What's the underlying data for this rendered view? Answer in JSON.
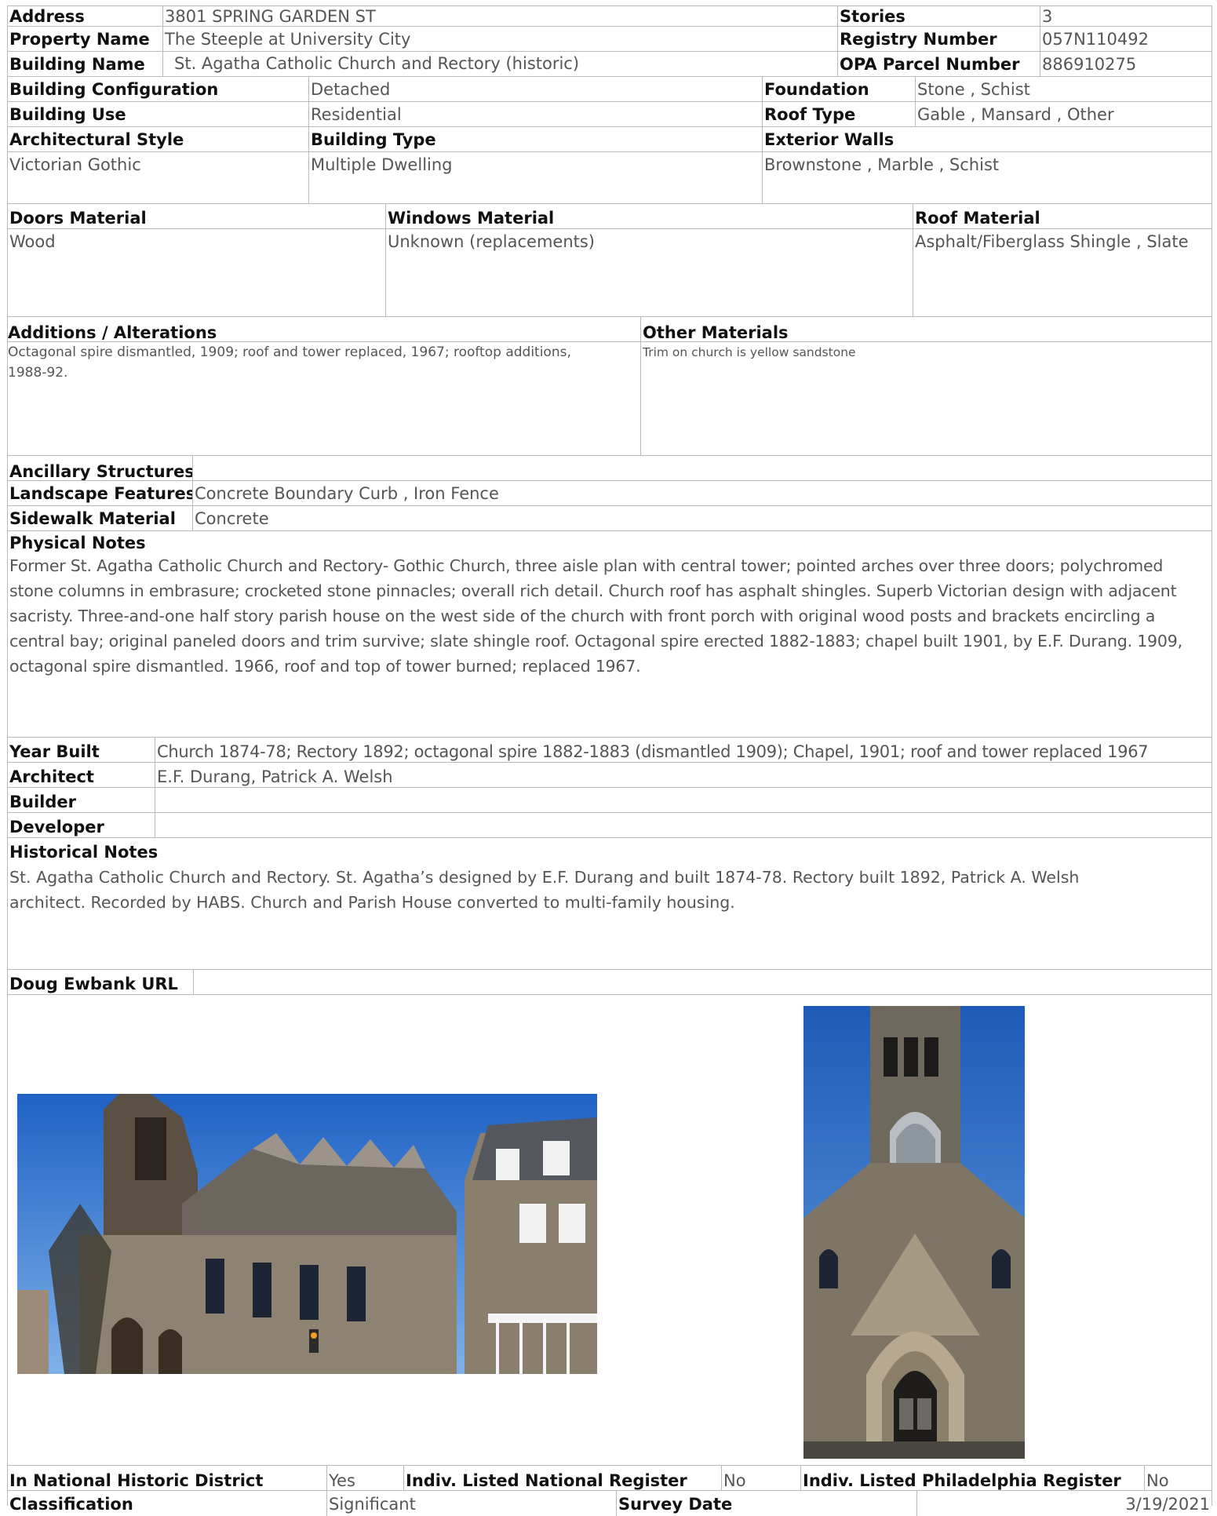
{
  "address": {
    "label": "Address",
    "value": "3801 SPRING GARDEN ST"
  },
  "property_name": {
    "label": "Property Name",
    "value": "The Steeple at University City"
  },
  "building_name": {
    "label": "Building Name",
    "value": "St. Agatha Catholic Church and Rectory (historic)"
  },
  "stories": {
    "label": "Stories",
    "value": "3"
  },
  "registry_number": {
    "label": "Registry Number",
    "value": "057N110492"
  },
  "opa_parcel": {
    "label": "OPA Parcel Number",
    "value": "886910275"
  },
  "building_configuration": {
    "label": "Building Configuration",
    "value": "Detached"
  },
  "building_use": {
    "label": "Building Use",
    "value": "Residential"
  },
  "foundation": {
    "label": "Foundation",
    "value": "Stone , Schist"
  },
  "roof_type": {
    "label": "Roof Type",
    "value": "Gable , Mansard , Other"
  },
  "architectural_style": {
    "label": "Architectural Style",
    "value": "Victorian Gothic"
  },
  "building_type": {
    "label": "Building Type",
    "value": "Multiple Dwelling"
  },
  "exterior_walls": {
    "label": "Exterior Walls",
    "value": "Brownstone , Marble , Schist"
  },
  "doors_material": {
    "label": "Doors Material",
    "value": "Wood"
  },
  "windows_material": {
    "label": "Windows Material",
    "value": "Unknown (replacements)"
  },
  "roof_material": {
    "label": "Roof Material",
    "value": "Asphalt/Fiberglass Shingle , Slate"
  },
  "additions": {
    "label": "Additions / Alterations",
    "value": "Octagonal spire dismantled, 1909; roof and tower replaced, 1967; rooftop additions, 1988-92."
  },
  "other_materials": {
    "label": "Other Materials",
    "value": "Trim on  church is yellow sandstone"
  },
  "ancillary_structures": {
    "label": "Ancillary Structures",
    "value": ""
  },
  "landscape_features": {
    "label": "Landscape Features",
    "value": "Concrete Boundary Curb , Iron Fence"
  },
  "sidewalk_material": {
    "label": "Sidewalk Material",
    "value": "Concrete"
  },
  "physical_notes": {
    "label": "Physical Notes",
    "value": "Former St. Agatha Catholic Church and Rectory- Gothic Church, three aisle plan with central tower; pointed arches over three doors; polychromed stone columns in embrasure; crocketed stone pinnacles; overall rich detail. Church roof has asphalt shingles. Superb Victorian design with adjacent sacristy. Three-and-one half story parish house on the west side of the church with front porch with original wood posts and brackets encircling a central bay; original paneled doors and trim survive; slate shingle roof.  Octagonal spire erected 1882-1883; chapel built 1901, by E.F. Durang. 1909, octagonal spire dismantled. 1966, roof and top of tower burned; replaced 1967."
  },
  "year_built": {
    "label": "Year Built",
    "value": "Church 1874-78; Rectory 1892; octagonal spire 1882-1883 (dismantled 1909); Chapel, 1901; roof and tower replaced 1967"
  },
  "architect": {
    "label": "Architect",
    "value": "E.F. Durang, Patrick A. Welsh"
  },
  "builder": {
    "label": "Builder",
    "value": ""
  },
  "developer": {
    "label": "Developer",
    "value": ""
  },
  "historical_notes": {
    "label": "Historical Notes",
    "value": "St. Agatha Catholic Church and Rectory.  St. Agatha’s designed by E.F. Durang and built 1874-78.  Rectory built 1892, Patrick A. Welsh architect. Recorded by HABS. Church and Parish House converted to multi-family housing."
  },
  "doug_ewbank_url": {
    "label": "Doug Ewbank URL",
    "value": ""
  },
  "national_district": {
    "label": "In National Historic District",
    "value": "Yes"
  },
  "national_register": {
    "label": "Indiv. Listed National Register",
    "value": "No"
  },
  "phila_register": {
    "label": "Indiv. Listed Philadelphia Register",
    "value": "No"
  },
  "classification": {
    "label": "Classification",
    "value": "Significant"
  },
  "survey_date": {
    "label": "Survey Date",
    "value": "3/19/2021"
  }
}
